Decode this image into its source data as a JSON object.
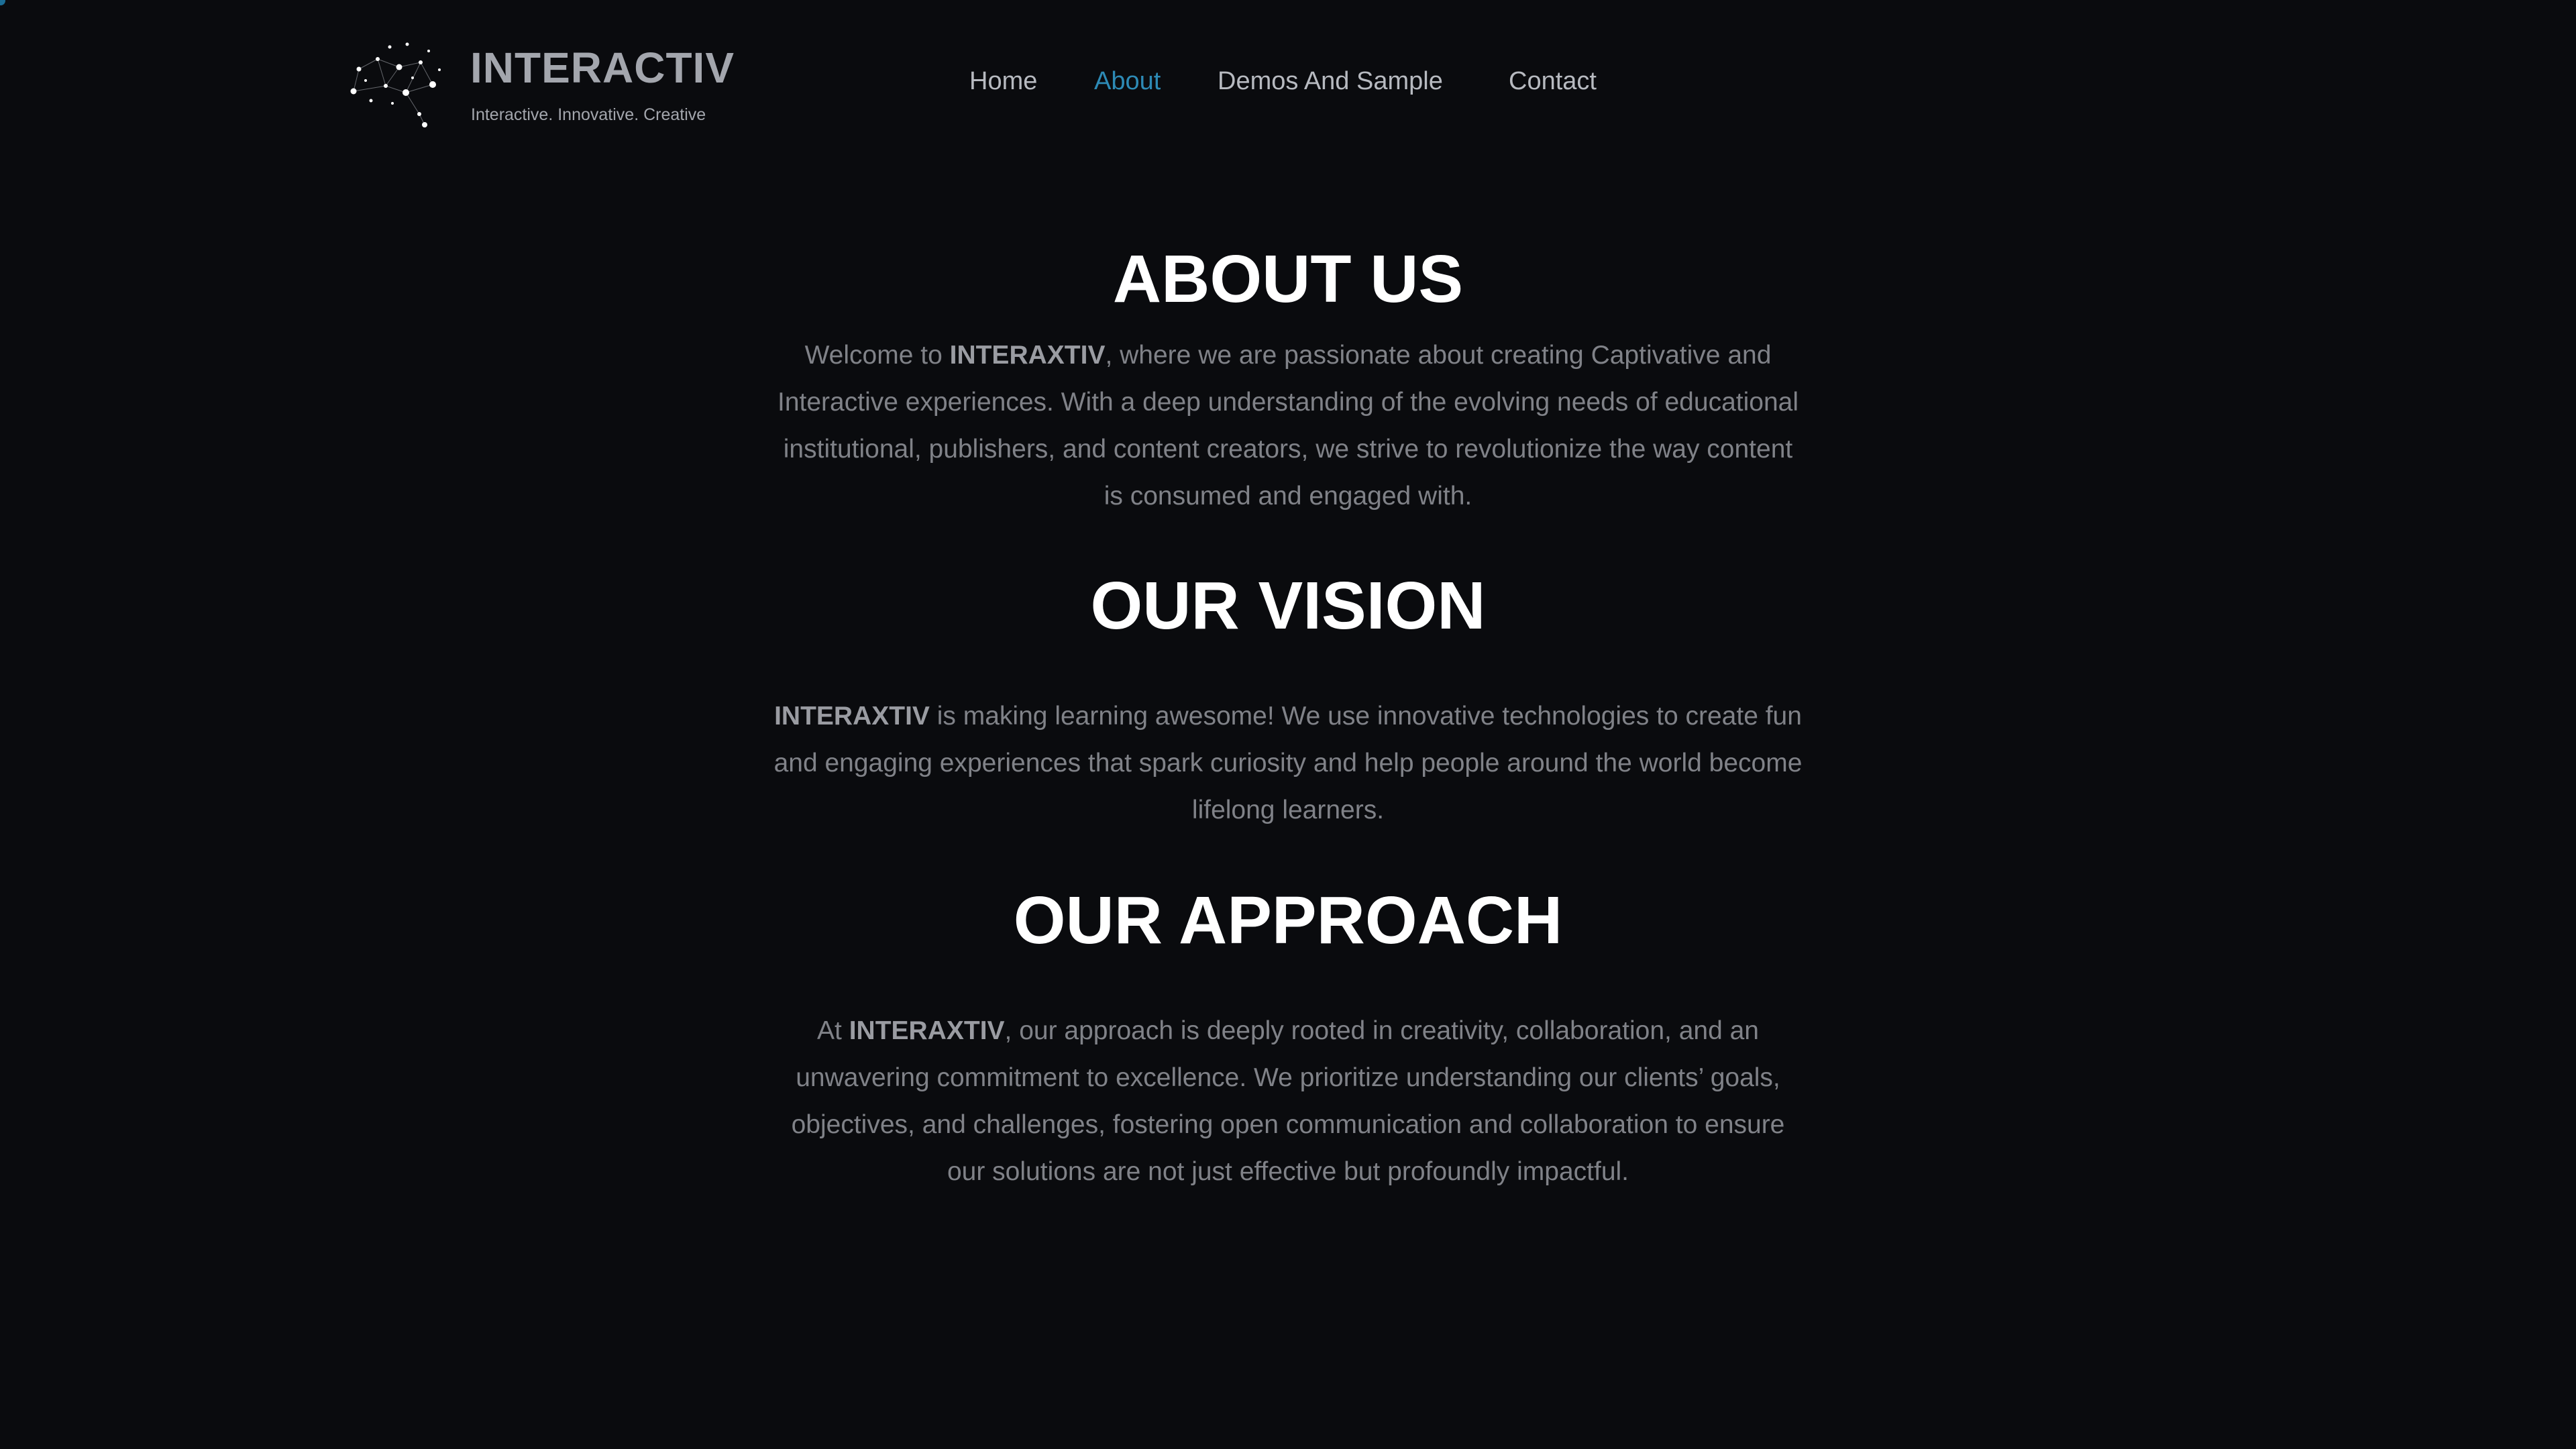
{
  "brand": {
    "name": "INTERACTIV",
    "tagline": "Interactive. Innovative. Creative",
    "logo_icon": "constellation-brain-icon"
  },
  "nav": {
    "items": [
      {
        "label": "Home"
      },
      {
        "label": "About"
      },
      {
        "label": "Demos And Sample"
      },
      {
        "label": "Contact"
      }
    ],
    "active": "About",
    "active_color": "#2d8ab5"
  },
  "sections": {
    "about": {
      "title": "ABOUT US",
      "lead": "Welcome to ",
      "company": "INTERAXTIV",
      "rest": ", where we are passionate about creating Captivative and Interactive experiences. With a deep understanding of the evolving needs of educational institutional, publishers, and content creators, we strive to revolutionize the way content is consumed and engaged with."
    },
    "vision": {
      "title": "OUR VISION",
      "company": "INTERAXTIV",
      "rest": " is making learning awesome! We use innovative technologies to create fun and engaging experiences that spark curiosity and help people around the world become lifelong learners."
    },
    "approach": {
      "title": "OUR APPROACH",
      "lead": "At ",
      "company": "INTERAXTIV",
      "rest": ", our approach is deeply rooted in creativity, collaboration, and an unwavering commitment to excellence. We prioritize understanding our clients’ goals, objectives, and challenges, fostering open communication and collaboration to ensure our solutions are not just effective but profoundly impactful."
    }
  },
  "colors": {
    "background": "#0a0b0e",
    "heading": "#ffffff",
    "body_text": "#808288",
    "nav_text": "#b7bac0"
  }
}
